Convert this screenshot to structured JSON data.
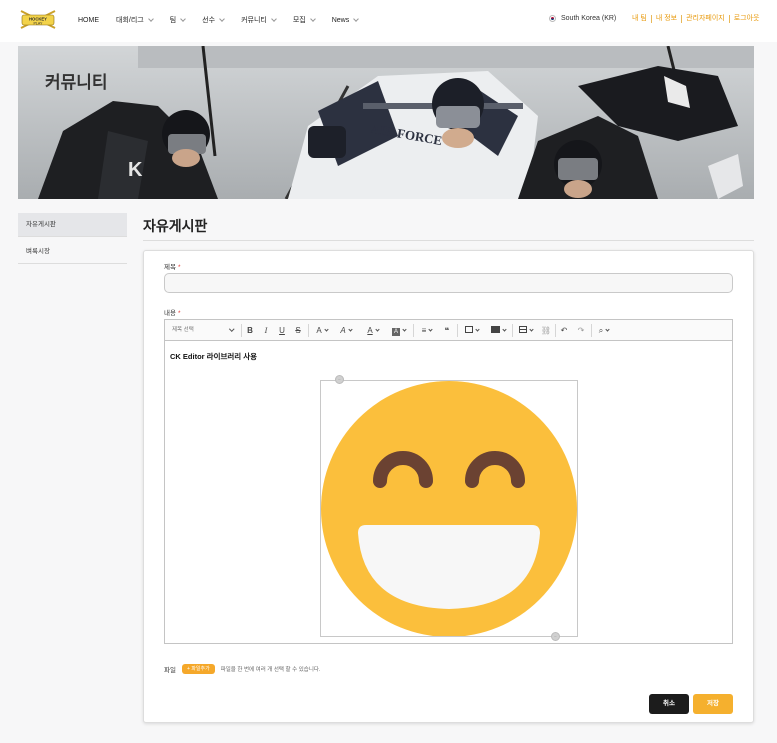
{
  "nav": {
    "logo_text": "HOCKEY PLAY",
    "menu": [
      {
        "label": "HOME",
        "dropdown": false
      },
      {
        "label": "대회/리그",
        "dropdown": true
      },
      {
        "label": "팀",
        "dropdown": true
      },
      {
        "label": "선수",
        "dropdown": true
      },
      {
        "label": "커뮤니티",
        "dropdown": true
      },
      {
        "label": "모집",
        "dropdown": true
      },
      {
        "label": "News",
        "dropdown": true
      }
    ],
    "country": "South Korea (KR)",
    "user_links": [
      "내 팀",
      "내 정보",
      "관리자페이지",
      "로그아웃"
    ],
    "accent_color": "#e89a0c"
  },
  "hero": {
    "title": "커뮤니티",
    "jersey_text": "AIR FORCE"
  },
  "sidebar": {
    "items": [
      {
        "label": "자유게시판",
        "active": true
      },
      {
        "label": "벼룩시장",
        "active": false
      }
    ]
  },
  "main": {
    "page_title": "자유게시판",
    "form": {
      "title_label": "제목",
      "title_value": "",
      "content_label": "내용",
      "required_mark": "*",
      "editor": {
        "heading_placeholder": "제목 선택",
        "toolbar_icons": [
          "bold-icon",
          "italic-icon",
          "underline-icon",
          "strikethrough-icon",
          "font-size-icon",
          "font-family-icon",
          "font-color-icon",
          "font-background-icon",
          "align-icon",
          "blockquote-icon",
          "image-icon",
          "media-icon",
          "table-icon",
          "link-icon",
          "undo-icon",
          "redo-icon",
          "find-replace-icon"
        ],
        "content_text": "CK Editor 라이브러리 사용",
        "image": "grinning-face-emoji"
      },
      "file_label": "파일",
      "add_file_label": "+ 파일추가",
      "file_help": "파일을 한 번에 여러 개 선택 할 수 있습니다.",
      "cancel_label": "취소",
      "save_label": "저장",
      "save_color": "#f5b02e"
    }
  }
}
